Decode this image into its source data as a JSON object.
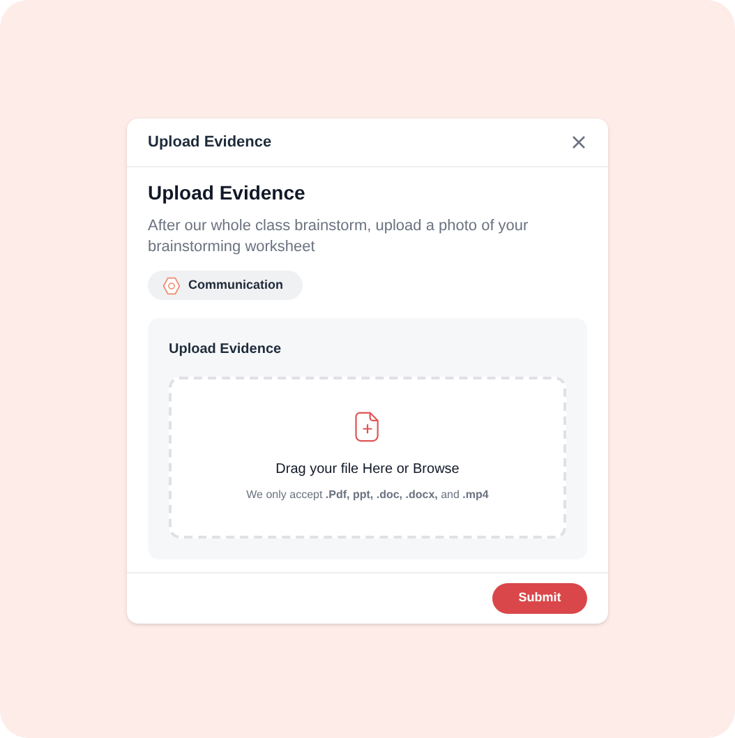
{
  "dialog": {
    "title": "Upload Evidence",
    "heading": "Upload Evidence",
    "description": "After our whole class brainstorm, upload a photo of your brainstorming worksheet",
    "tag": "Communication",
    "upload": {
      "title": "Upload Evidence",
      "prompt": "Drag your file Here or Browse",
      "accepted": "We only accept **.Pdf, ppt, .doc, .docx,** and **.mp4**"
    },
    "submit": "Submit"
  }
}
